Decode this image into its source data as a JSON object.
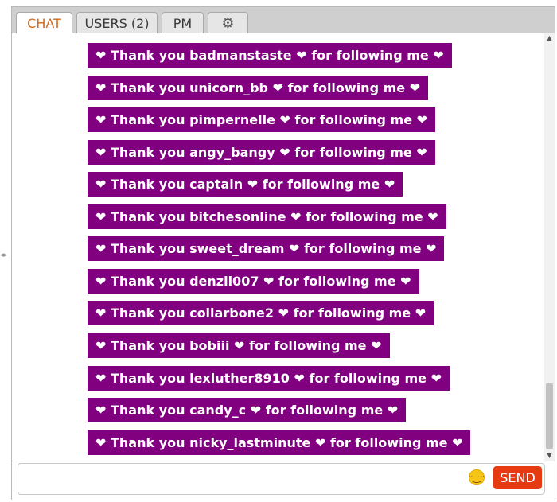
{
  "tabs": [
    {
      "label": "CHAT",
      "active": true
    },
    {
      "label": "USERS (2)",
      "active": false
    },
    {
      "label": "PM",
      "active": false
    }
  ],
  "settings_icon": "gear-icon",
  "messages": [
    {
      "prefix": "Thank you",
      "user": "badmanstaste",
      "suffix": "for following me"
    },
    {
      "prefix": "Thank you",
      "user": "unicorn_bb",
      "suffix": "for following me"
    },
    {
      "prefix": "Thank you",
      "user": "pimpernelle",
      "suffix": "for following me"
    },
    {
      "prefix": "Thank you",
      "user": "angy_bangy",
      "suffix": "for following me"
    },
    {
      "prefix": "Thank you",
      "user": "captain",
      "suffix": "for following me"
    },
    {
      "prefix": "Thank you",
      "user": "bitchesonline",
      "suffix": "for following me"
    },
    {
      "prefix": "Thank you",
      "user": "sweet_dream",
      "suffix": "for following me"
    },
    {
      "prefix": "Thank you",
      "user": "denzil007",
      "suffix": "for following me"
    },
    {
      "prefix": "Thank you",
      "user": "collarbone2",
      "suffix": "for following me"
    },
    {
      "prefix": "Thank you",
      "user": "bobiii",
      "suffix": "for following me"
    },
    {
      "prefix": "Thank you",
      "user": "lexluther8910",
      "suffix": "for following me"
    },
    {
      "prefix": "Thank you",
      "user": "candy_c",
      "suffix": "for following me"
    },
    {
      "prefix": "Thank you",
      "user": "nicky_lastminute",
      "suffix": "for following me"
    }
  ],
  "input": {
    "value": "",
    "placeholder": ""
  },
  "send_label": "SEND",
  "colors": {
    "message_bg": "#800080",
    "send_bg": "#e63a12",
    "active_tab_text": "#d2691e"
  }
}
